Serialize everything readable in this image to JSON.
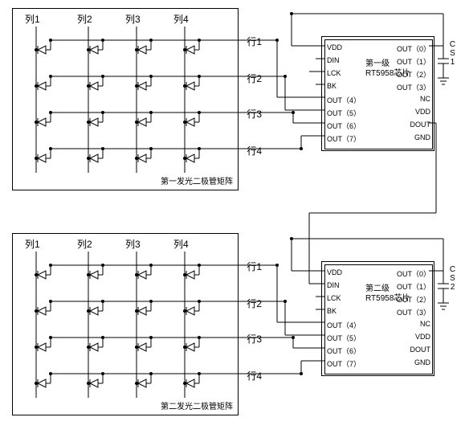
{
  "matrix1": {
    "label": "第一发光二极管矩阵",
    "cols": [
      "列1",
      "列2",
      "列3",
      "列4"
    ],
    "rows": [
      "行1",
      "行2",
      "行3",
      "行4"
    ]
  },
  "matrix2": {
    "label": "第二发光二极管矩阵",
    "cols": [
      "列1",
      "列2",
      "列3",
      "列4"
    ],
    "rows": [
      "行1",
      "行2",
      "行3",
      "行4"
    ]
  },
  "chip1": {
    "title_line1": "第一级",
    "title_line2": "RT5958芯片",
    "pins_left": [
      "VDD",
      "DIN",
      "LCK",
      "BK",
      "OUT（4）",
      "OUT（5）",
      "OUT（6）",
      "OUT（7）"
    ],
    "pins_right": [
      "OUT（0）",
      "OUT（1）",
      "OUT（2）",
      "OUT（3）",
      "NC",
      "VDD",
      "DOUT",
      "GND"
    ]
  },
  "chip2": {
    "title_line1": "第二级",
    "title_line2": "RT5958芯片",
    "pins_left": [
      "VDD",
      "DIN",
      "LCK",
      "BK",
      "OUT（4）",
      "OUT（5）",
      "OUT（6）",
      "OUT（7）"
    ],
    "pins_right": [
      "OUT（0）",
      "OUT（1）",
      "OUT（2）",
      "OUT（3）",
      "NC",
      "VDD",
      "DOUT",
      "GND"
    ]
  },
  "cs1": "CS1",
  "cs2": "CS2"
}
